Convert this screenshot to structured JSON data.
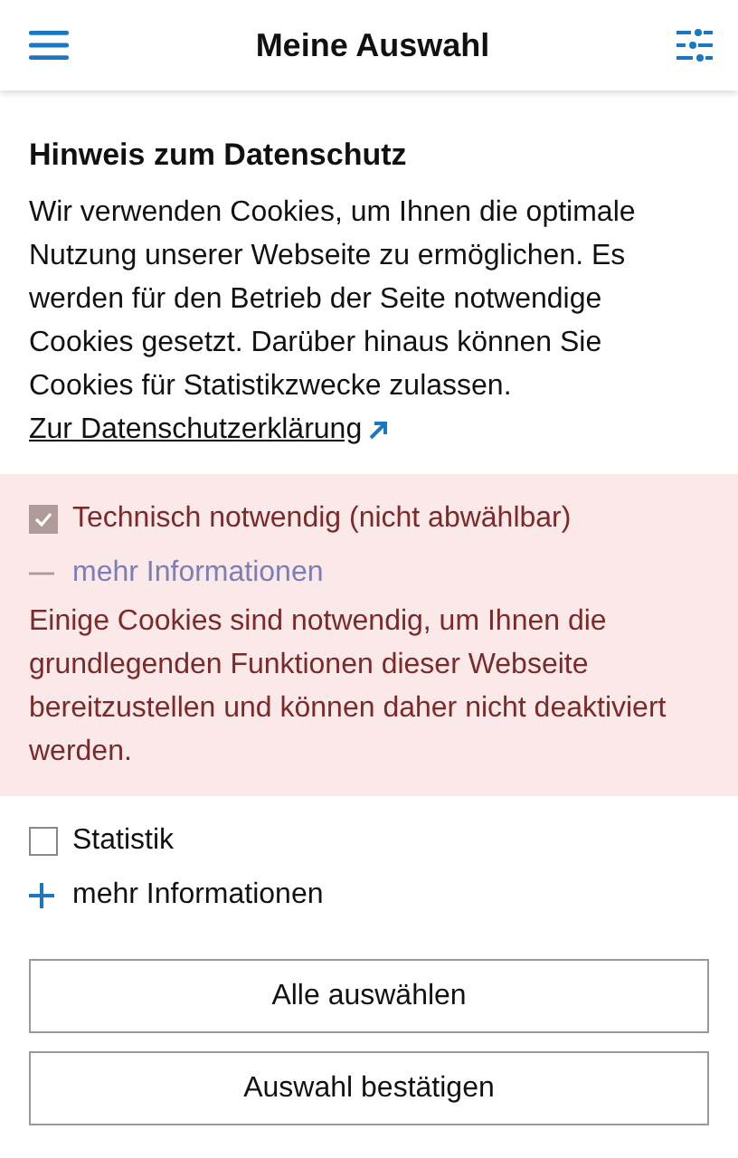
{
  "header": {
    "title": "Meine Auswahl"
  },
  "notice": {
    "title": "Hinweis zum Datenschutz",
    "text": "Wir verwenden Cookies, um Ihnen die optimale Nutzung unserer Webseite zu ermöglichen. Es werden für den Betrieb der Seite notwendige Cookies gesetzt. Darüber hinaus können Sie Cookies für Statistikzwecke zulassen.",
    "link": "Zur Datenschutzerklärung"
  },
  "categories": [
    {
      "label": "Technisch notwendig (nicht abwählbar)",
      "checked": true,
      "disabled": true,
      "expanded": true,
      "toggle": "mehr Informationen",
      "description": "Einige Cookies sind notwendig, um Ihnen die grundlegenden Funktionen dieser Webseite bereitzustellen und können daher nicht deaktiviert werden."
    },
    {
      "label": "Statistik",
      "checked": false,
      "disabled": false,
      "expanded": false,
      "toggle": "mehr Informationen"
    }
  ],
  "buttons": [
    "Alle auswählen",
    "Auswahl bestätigen"
  ]
}
